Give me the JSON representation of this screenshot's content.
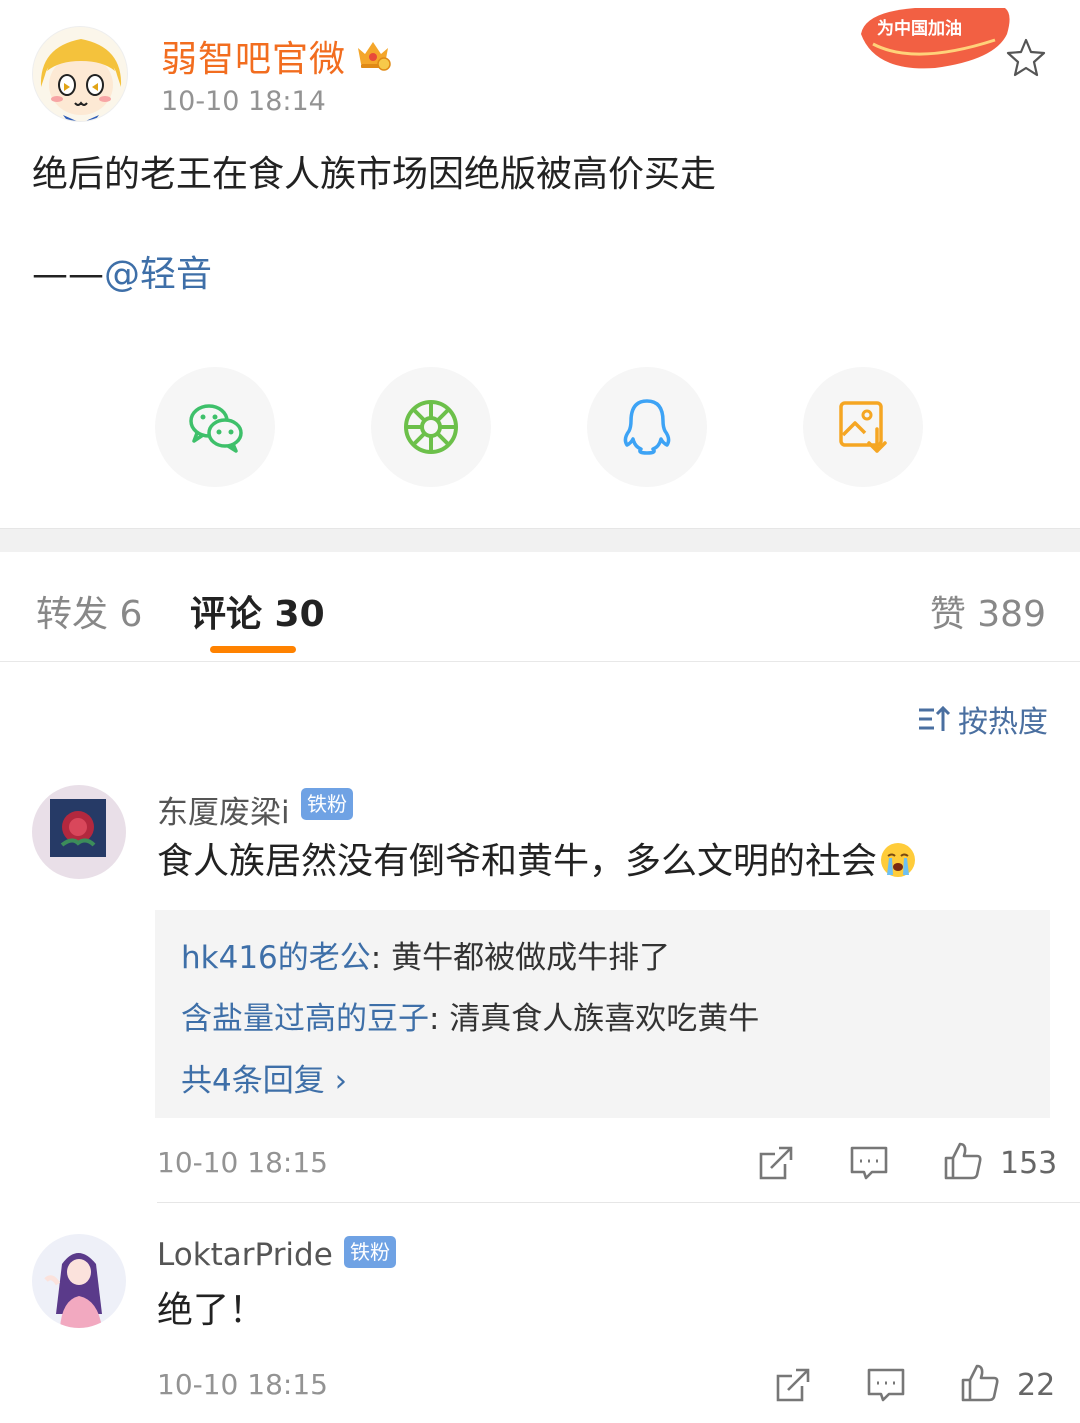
{
  "post": {
    "author": "弱智吧官微",
    "time": "10-10 18:14",
    "text": "绝后的老王在食人族市场因绝版被高价买走",
    "sign_prefix": "——",
    "sign_mention": "@轻音",
    "badge_text": "为中国加油"
  },
  "share": [
    "wechat-icon",
    "moments-icon",
    "qq-icon",
    "save-image-icon"
  ],
  "tabs": {
    "repost_label": "转发 6",
    "comments_label": "评论 30",
    "likes_label": "赞 389"
  },
  "sort": {
    "label": "按热度"
  },
  "comments": [
    {
      "user": "东厦废梁i",
      "badge": "铁粉",
      "text": "食人族居然没有倒爷和黄牛，多么文明的社会",
      "emoji": "crying-emoji",
      "replies": [
        {
          "user": "hk416的老公",
          "sep": ": ",
          "text": "黄牛都被做成牛排了"
        },
        {
          "user": "含盐量过高的豆子",
          "sep": ": ",
          "text": "清真食人族喜欢吃黄牛"
        }
      ],
      "more_replies": "共4条回复 ›",
      "time": "10-10 18:15",
      "likes": "153"
    },
    {
      "user": "LoktarPride",
      "badge": "铁粉",
      "text": "绝了！",
      "time": "10-10 18:15",
      "likes": "22"
    }
  ],
  "colors": {
    "accent": "#ff8200",
    "author": "#f26d1f",
    "link": "#3e6fa8",
    "badge": "#6fa2e4"
  }
}
